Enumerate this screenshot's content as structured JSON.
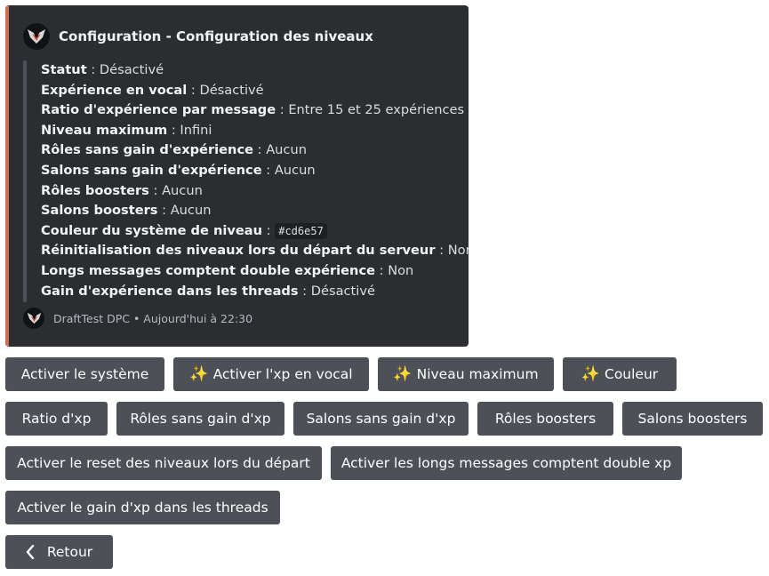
{
  "embed": {
    "accent_color": "#cd6e57",
    "title": "Configuration - Configuration des niveaux",
    "fields": [
      {
        "key": "Statut",
        "sep": " : ",
        "value": "Désactivé"
      },
      {
        "key": "Expérience en vocal",
        "sep": " : ",
        "value": "Désactivé"
      },
      {
        "key": "Ratio d'expérience par message",
        "sep": " : ",
        "value": "Entre 15 et 25 expériences"
      },
      {
        "key": "Niveau maximum",
        "sep": " : ",
        "value": "Infini"
      },
      {
        "key": "Rôles sans gain d'expérience",
        "sep": " : ",
        "value": "Aucun"
      },
      {
        "key": "Salons sans gain d'expérience",
        "sep": " : ",
        "value": "Aucun"
      },
      {
        "key": "Rôles boosters",
        "sep": " : ",
        "value": "Aucun"
      },
      {
        "key": "Salons boosters",
        "sep": " : ",
        "value": "Aucun"
      },
      {
        "key": "Couleur du système de niveau",
        "sep": " : ",
        "value": "#cd6e57"
      },
      {
        "key": "Réinitialisation des niveaux lors du départ du serveur",
        "sep": " : ",
        "value": "Non"
      },
      {
        "key": "Longs messages comptent double expérience",
        "sep": " : ",
        "value": "Non"
      },
      {
        "key": "Gain d'expérience dans les threads",
        "sep": " : ",
        "value": "Désactivé"
      }
    ],
    "footer": "DraftTest DPC • Aujourd'hui à 22:30"
  },
  "buttons": {
    "activate_system": "Activer le système",
    "activate_voice_xp": "Activer l'xp en vocal",
    "max_level": "Niveau maximum",
    "color": "Couleur",
    "xp_ratio": "Ratio d'xp",
    "roles_no_xp": "Rôles sans gain d'xp",
    "channels_no_xp": "Salons sans gain d'xp",
    "roles_boosters": "Rôles boosters",
    "channels_boosters": "Salons boosters",
    "reset_on_leave": "Activer le reset des niveaux lors du départ",
    "long_messages": "Activer les longs messages comptent double xp",
    "threads_xp": "Activer le gain d'xp dans les threads",
    "back": "Retour",
    "sparkle_emoji": "✨"
  }
}
